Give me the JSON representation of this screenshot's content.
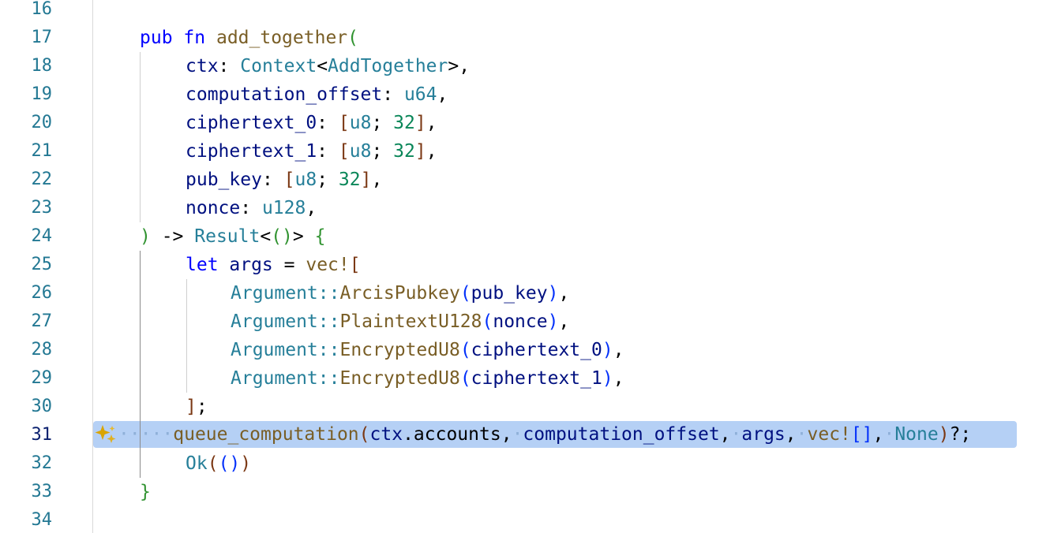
{
  "editor": {
    "active_line": "31",
    "gutter": [
      "16",
      "17",
      "18",
      "19",
      "20",
      "21",
      "22",
      "23",
      "24",
      "25",
      "26",
      "27",
      "28",
      "29",
      "30",
      "31",
      "32",
      "33",
      "34"
    ],
    "code": {
      "l17": {
        "kw_pub": "pub",
        "kw_fn": "fn",
        "fn_name": "add_together",
        "paren": "("
      },
      "l18": {
        "name": "ctx",
        "colon": ": ",
        "type": "Context",
        "lt": "<",
        "inner": "AddTogether",
        "gt": ">,"
      },
      "l19": {
        "name": "computation_offset",
        "colon": ": ",
        "type": "u64",
        "comma": ","
      },
      "l20": {
        "name": "ciphertext_0",
        "colon": ": ",
        "lb": "[",
        "type": "u8",
        "semi": "; ",
        "num": "32",
        "rb": "]",
        "comma": ","
      },
      "l21": {
        "name": "ciphertext_1",
        "colon": ": ",
        "lb": "[",
        "type": "u8",
        "semi": "; ",
        "num": "32",
        "rb": "]",
        "comma": ","
      },
      "l22": {
        "name": "pub_key",
        "colon": ": ",
        "lb": "[",
        "type": "u8",
        "semi": "; ",
        "num": "32",
        "rb": "]",
        "comma": ","
      },
      "l23": {
        "name": "nonce",
        "colon": ": ",
        "type": "u128",
        "comma": ","
      },
      "l24": {
        "rp": ")",
        "arrow": " -> ",
        "type": "Result",
        "lt": "<",
        "unit": "()",
        "gt": "> ",
        "lb": "{"
      },
      "l25": {
        "kw": "let",
        "name": " args",
        "eq": " = ",
        "mac": "vec!",
        "lb": "["
      },
      "l26": {
        "ty": "Argument",
        "sep": "::",
        "fn": "ArcisPubkey",
        "lp": "(",
        "arg": "pub_key",
        "rp": ")",
        "comma": ","
      },
      "l27": {
        "ty": "Argument",
        "sep": "::",
        "fn": "PlaintextU128",
        "lp": "(",
        "arg": "nonce",
        "rp": ")",
        "comma": ","
      },
      "l28": {
        "ty": "Argument",
        "sep": "::",
        "fn": "EncryptedU8",
        "lp": "(",
        "arg": "ciphertext_0",
        "rp": ")",
        "comma": ","
      },
      "l29": {
        "ty": "Argument",
        "sep": "::",
        "fn": "EncryptedU8",
        "lp": "(",
        "arg": "ciphertext_1",
        "rp": ")",
        "comma": ","
      },
      "l30": {
        "rb": "]",
        "semi": ";"
      },
      "l31": {
        "dots": "·····",
        "fn": "queue_computation",
        "lp": "(",
        "a1": "ctx",
        "dot": ".",
        "a1b": "accounts",
        "c1": ",",
        "d1": "·",
        "a2": "computation_offset",
        "c2": ",",
        "d2": "·",
        "a3": "args",
        "c3": ",",
        "d3": "·",
        "mac": "vec!",
        "br": "[]",
        "c4": ",",
        "d4": "·",
        "none": "None",
        "rp": ")",
        "tail": "?;"
      },
      "l32": {
        "ok": "Ok",
        "lp": "(",
        "unit": "()",
        "rp": ")"
      },
      "l33": {
        "rb": "}"
      }
    },
    "icons": {
      "ai_sparkle": "sparkle-icon"
    },
    "colors": {
      "keyword": "#0000ff",
      "function": "#795e26",
      "variable": "#001080",
      "type": "#267f99",
      "number": "#098658",
      "line_number": "#237893",
      "selection": "#b5d0f5"
    }
  }
}
